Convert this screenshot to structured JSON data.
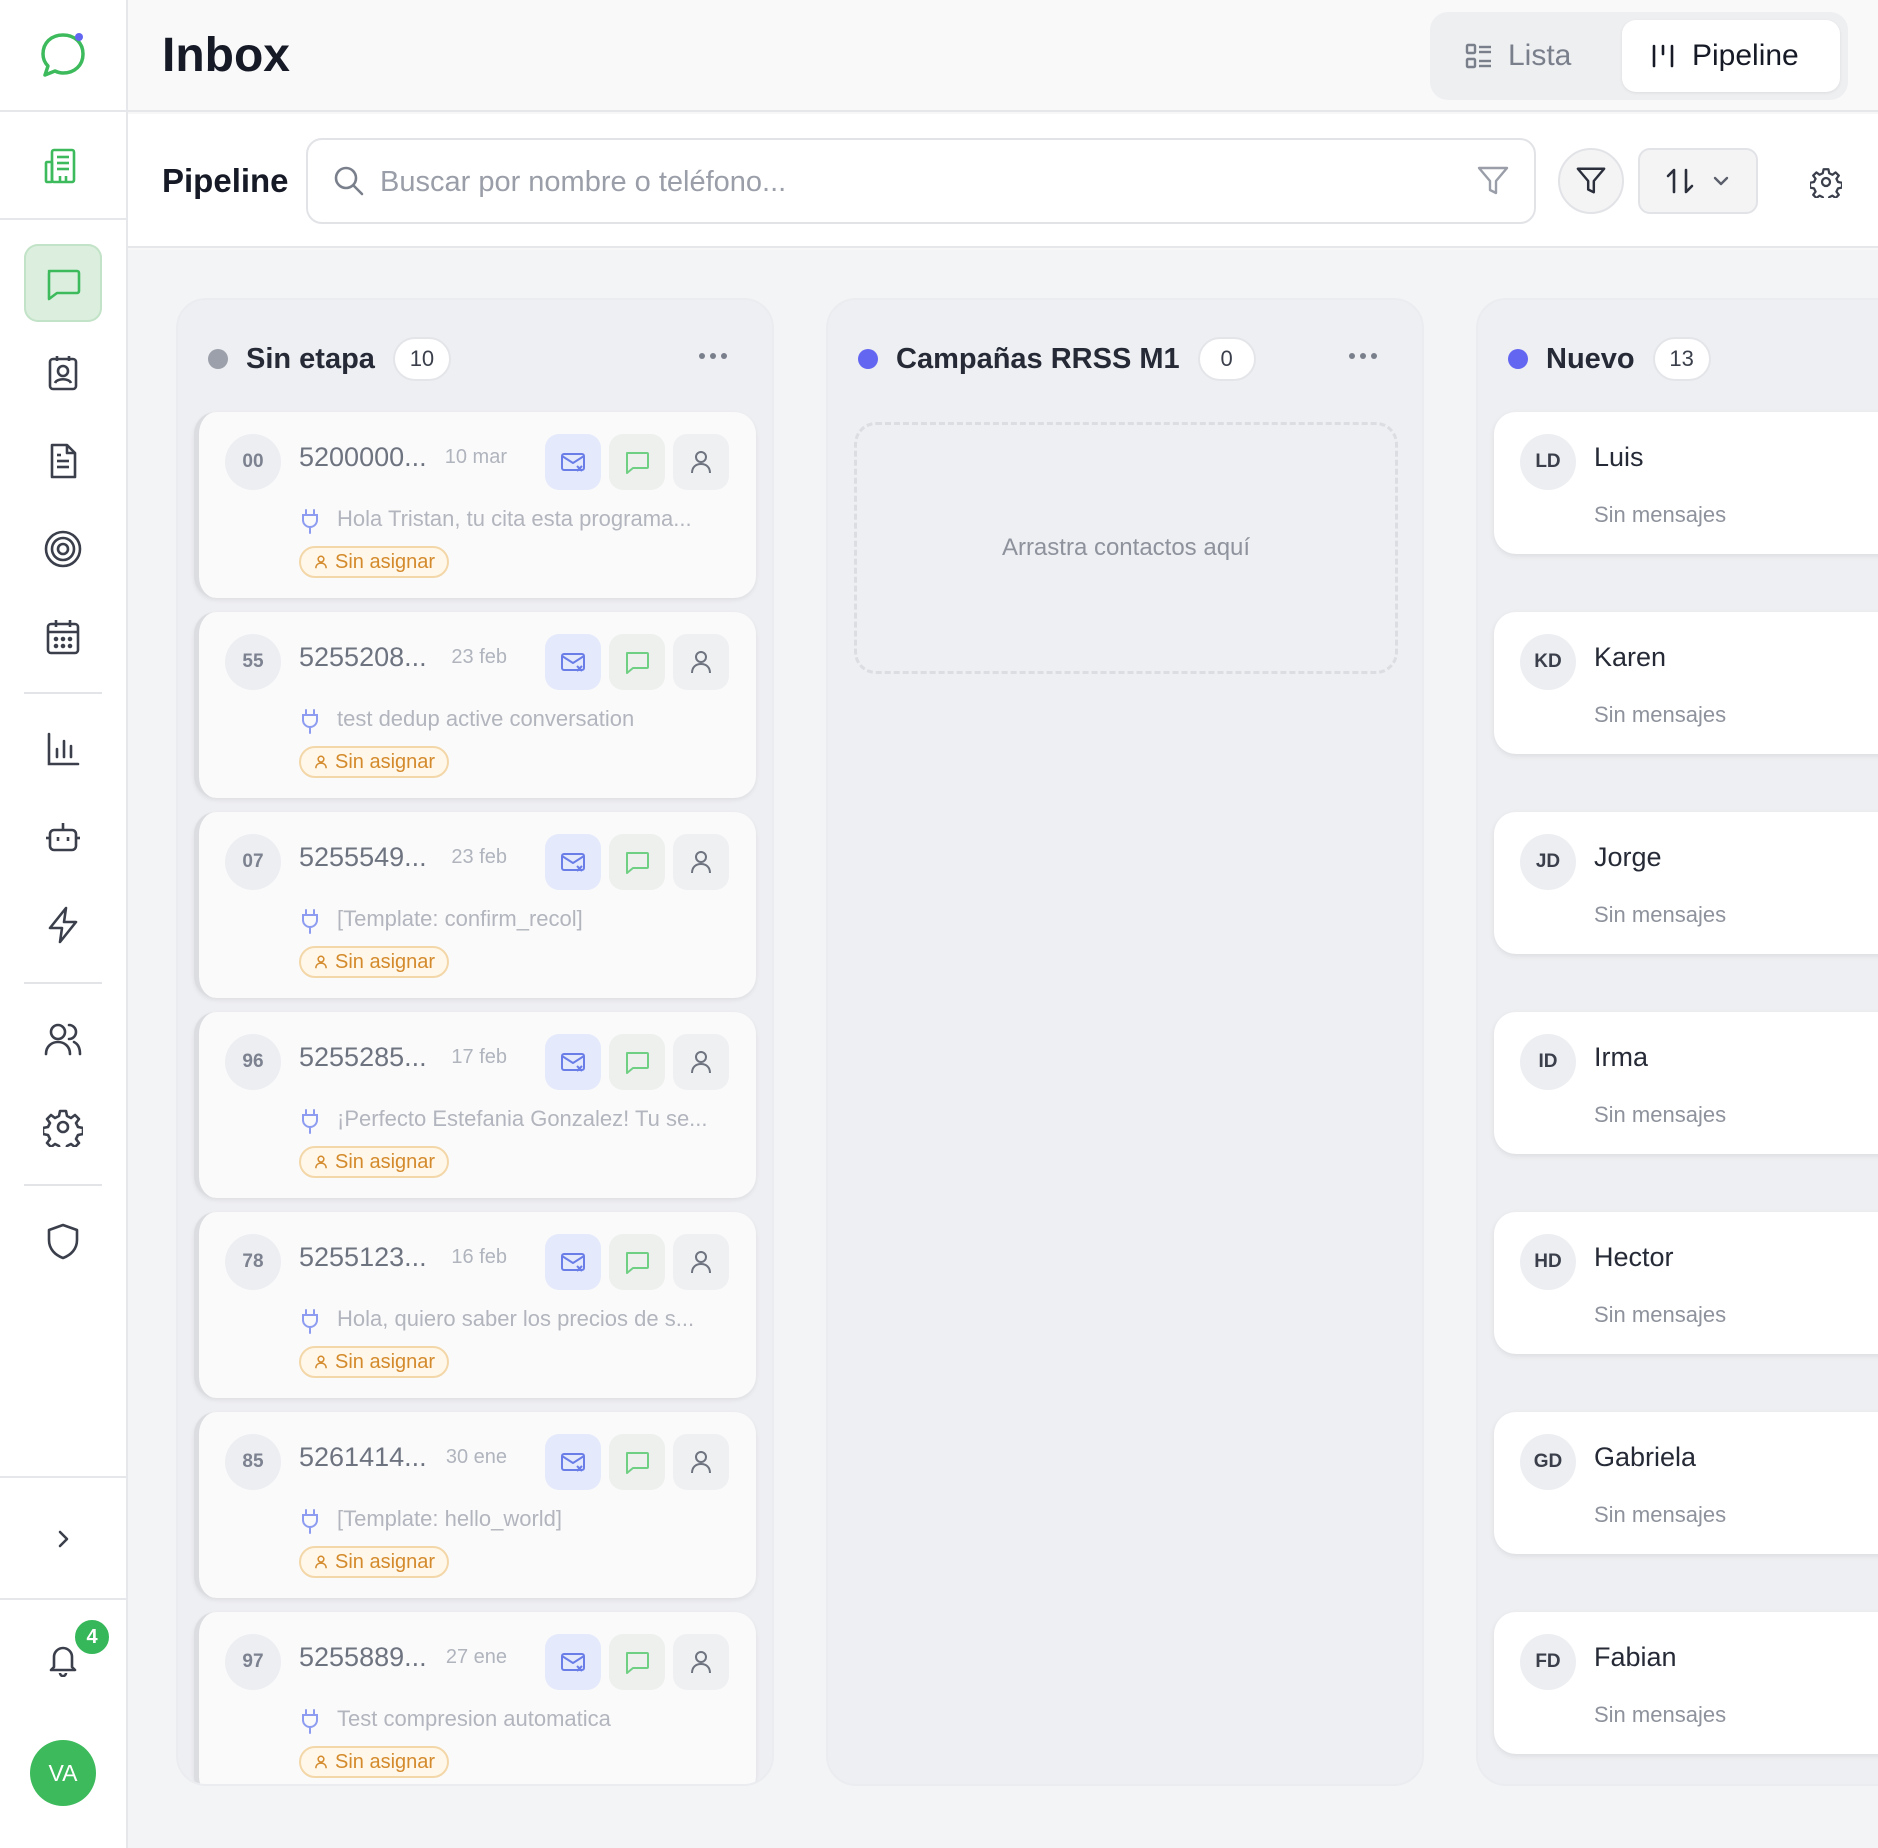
{
  "header": {
    "title": "Inbox",
    "views": [
      {
        "label": "Lista",
        "icon": "list-icon"
      },
      {
        "label": "Pipeline",
        "icon": "pipeline-icon"
      }
    ],
    "active_view": "Pipeline"
  },
  "toolbar": {
    "title": "Pipeline",
    "search_placeholder": "Buscar por nombre o teléfono..."
  },
  "sidebar": {
    "items": [
      {
        "icon": "building-icon"
      },
      {
        "icon": "chat-icon",
        "active": true
      },
      {
        "icon": "contact-card-icon"
      },
      {
        "icon": "document-icon"
      },
      {
        "icon": "target-icon"
      },
      {
        "icon": "calendar-icon"
      },
      {
        "icon": "bar-chart-icon"
      },
      {
        "icon": "bot-icon"
      },
      {
        "icon": "lightning-icon"
      },
      {
        "icon": "users-icon"
      },
      {
        "icon": "settings-icon"
      },
      {
        "icon": "shield-icon"
      }
    ],
    "notifications_count": "4",
    "user_initials": "VA"
  },
  "columns": [
    {
      "name": "Sin etapa",
      "count": "10",
      "color": "#9ca0aa",
      "cards": [
        {
          "avatar": "00",
          "phone": "5200000...",
          "date": "10 mar",
          "message": "Hola Tristan, tu cita esta programa...",
          "tag": "Sin asignar"
        },
        {
          "avatar": "55",
          "phone": "5255208...",
          "date": "23 feb",
          "message": "test dedup active conversation",
          "tag": "Sin asignar"
        },
        {
          "avatar": "07",
          "phone": "5255549...",
          "date": "23 feb",
          "message": "[Template: confirm_recol]",
          "tag": "Sin asignar"
        },
        {
          "avatar": "96",
          "phone": "5255285...",
          "date": "17 feb",
          "message": "¡Perfecto Estefania Gonzalez! Tu se...",
          "tag": "Sin asignar"
        },
        {
          "avatar": "78",
          "phone": "5255123...",
          "date": "16 feb",
          "message": "Hola, quiero saber los precios de s...",
          "tag": "Sin asignar"
        },
        {
          "avatar": "85",
          "phone": "5261414...",
          "date": "30 ene",
          "message": "[Template: hello_world]",
          "tag": "Sin asignar"
        },
        {
          "avatar": "97",
          "phone": "5255889...",
          "date": "27 ene",
          "message": "Test compresion automatica",
          "tag": "Sin asignar"
        }
      ]
    },
    {
      "name": "Campañas RRSS M1",
      "count": "0",
      "color": "#6366f1",
      "empty_text": "Arrastra contactos aquí"
    },
    {
      "name": "Nuevo",
      "count": "13",
      "color": "#6366f1",
      "cards": [
        {
          "avatar": "LD",
          "name": "Luis",
          "subtitle": "Sin mensajes"
        },
        {
          "avatar": "KD",
          "name": "Karen",
          "subtitle": "Sin mensajes"
        },
        {
          "avatar": "JD",
          "name": "Jorge",
          "subtitle": "Sin mensajes"
        },
        {
          "avatar": "ID",
          "name": "Irma",
          "subtitle": "Sin mensajes"
        },
        {
          "avatar": "HD",
          "name": "Hector",
          "subtitle": "Sin mensajes"
        },
        {
          "avatar": "GD",
          "name": "Gabriela",
          "subtitle": "Sin mensajes"
        },
        {
          "avatar": "FD",
          "name": "Fabian",
          "subtitle": "Sin mensajes"
        }
      ]
    }
  ],
  "colors": {
    "brand_green": "#3dba5c",
    "accent_indigo": "#6366f1",
    "tag_orange": "#d48a2c"
  }
}
